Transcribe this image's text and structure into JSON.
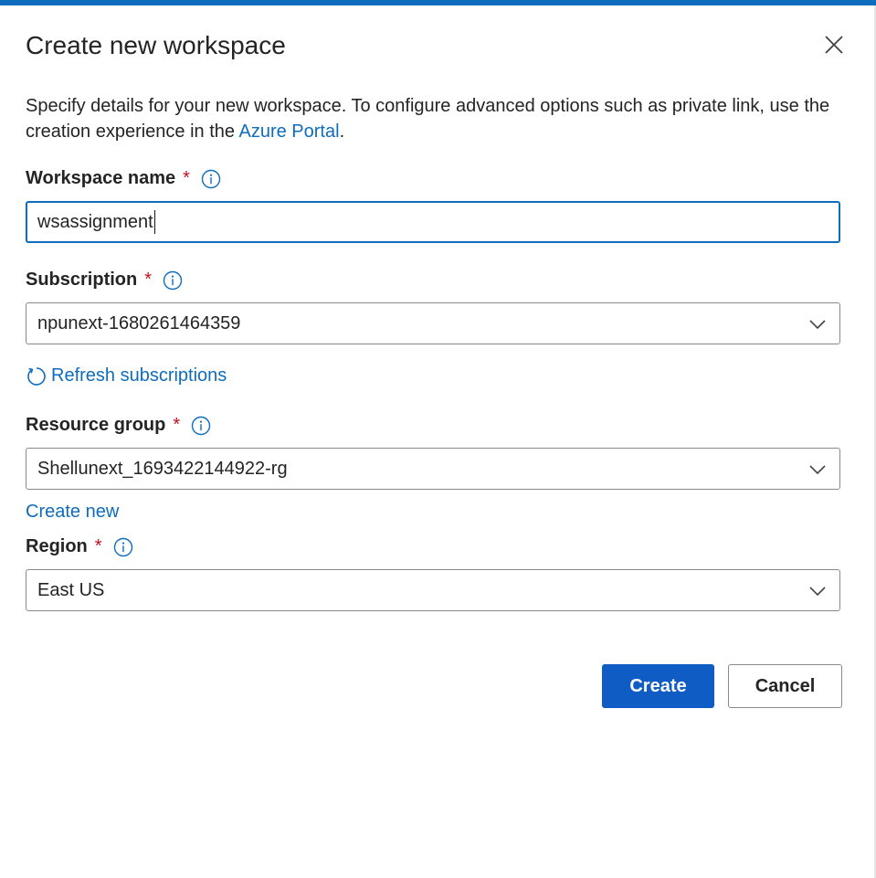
{
  "dialog": {
    "title": "Create new workspace",
    "description_prefix": "Specify details for your new workspace. To configure advanced options such as private link, use the creation experience in the ",
    "description_link": "Azure Portal",
    "description_suffix": "."
  },
  "fields": {
    "workspace_name": {
      "label": "Workspace name",
      "required_mark": "*",
      "value": "wsassignment"
    },
    "subscription": {
      "label": "Subscription",
      "required_mark": "*",
      "value": "npunext-1680261464359"
    },
    "refresh": {
      "label": "Refresh subscriptions"
    },
    "resource_group": {
      "label": "Resource group",
      "required_mark": "*",
      "value": "Shellunext_1693422144922-rg"
    },
    "create_new": {
      "label": "Create new"
    },
    "region": {
      "label": "Region",
      "required_mark": "*",
      "value": "East US"
    }
  },
  "buttons": {
    "create": "Create",
    "cancel": "Cancel"
  },
  "icons": {
    "close": "close-icon",
    "info": "info-icon",
    "chevron": "chevron-down-icon",
    "refresh": "refresh-icon"
  },
  "colors": {
    "accent": "#0f6cbd",
    "primary_button": "#0f5cc4",
    "required": "#c50f1f"
  }
}
